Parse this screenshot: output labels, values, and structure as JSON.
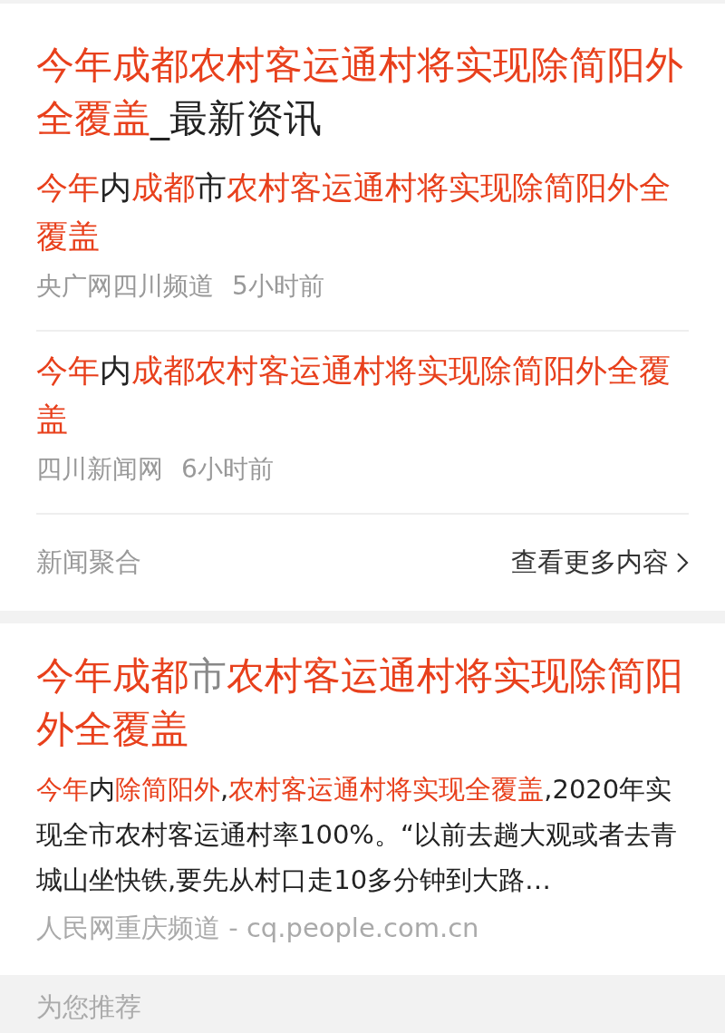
{
  "cards": [
    {
      "kind": "news_cluster",
      "title": [
        {
          "text": "今年成都农村客运通村将实现除简阳外全覆盖",
          "highlight": true
        },
        {
          "text": "_最新资讯",
          "highlight": false
        }
      ],
      "items": [
        {
          "title": [
            {
              "text": "今年",
              "highlight": true
            },
            {
              "text": "内",
              "highlight": false
            },
            {
              "text": "成都",
              "highlight": true
            },
            {
              "text": "市",
              "highlight": false
            },
            {
              "text": "农村客运通村将实现除简阳外全覆盖",
              "highlight": true
            }
          ],
          "source": "央广网四川频道",
          "time": "5小时前"
        },
        {
          "title": [
            {
              "text": "今年",
              "highlight": true
            },
            {
              "text": "内",
              "highlight": false
            },
            {
              "text": "成都农村客运通村将实现除简阳外全覆盖",
              "highlight": true
            }
          ],
          "source": "四川新闻网",
          "time": "6小时前"
        }
      ],
      "footer": {
        "label": "新闻聚合",
        "more": "查看更多内容"
      }
    },
    {
      "kind": "article",
      "title": [
        {
          "text": "今年成都",
          "highlight": true
        },
        {
          "text": "市",
          "highlight": false
        },
        {
          "text": "农村客运通村将实现除简阳外全覆盖",
          "highlight": true
        }
      ],
      "snippet": [
        {
          "text": "今年",
          "highlight": true
        },
        {
          "text": "内",
          "highlight": false
        },
        {
          "text": "除简阳外",
          "highlight": true
        },
        {
          "text": ",",
          "highlight": false
        },
        {
          "text": "农村客运通村将实现全覆盖",
          "highlight": true
        },
        {
          "text": ",2020年实现全市农村客运通村率100%。“以前去趟大观或者去青城山坐快铁,要先从村口走10多分钟到大路…",
          "highlight": false
        }
      ],
      "source": "人民网重庆频道 - cq.people.com.cn"
    }
  ],
  "section_header": "为您推荐"
}
